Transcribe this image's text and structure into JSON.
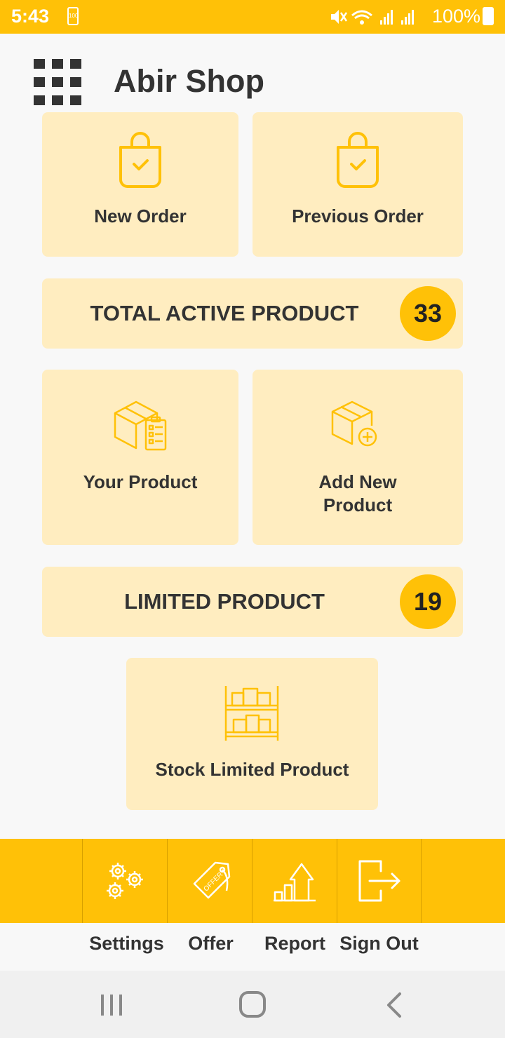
{
  "status": {
    "time": "5:43",
    "battery_small": "100",
    "battery": "100%"
  },
  "app": {
    "title": "Abir Shop"
  },
  "cards": {
    "new_order": "New Order",
    "previous_order": "Previous Order",
    "your_product": "Your Product",
    "add_new_product_1": "Add New",
    "add_new_product_2": "Product",
    "stock_limited": "Stock Limited Product"
  },
  "banners": {
    "total_active": {
      "label": "TOTAL ACTIVE PRODUCT",
      "count": "33"
    },
    "limited": {
      "label": "LIMITED PRODUCT",
      "count": "19"
    }
  },
  "bottom_nav": {
    "settings": "Settings",
    "offer": "Offer",
    "report": "Report",
    "sign_out": "Sign Out"
  },
  "colors": {
    "accent": "#FFC107",
    "card": "#FFEDC0",
    "text": "#333333"
  }
}
